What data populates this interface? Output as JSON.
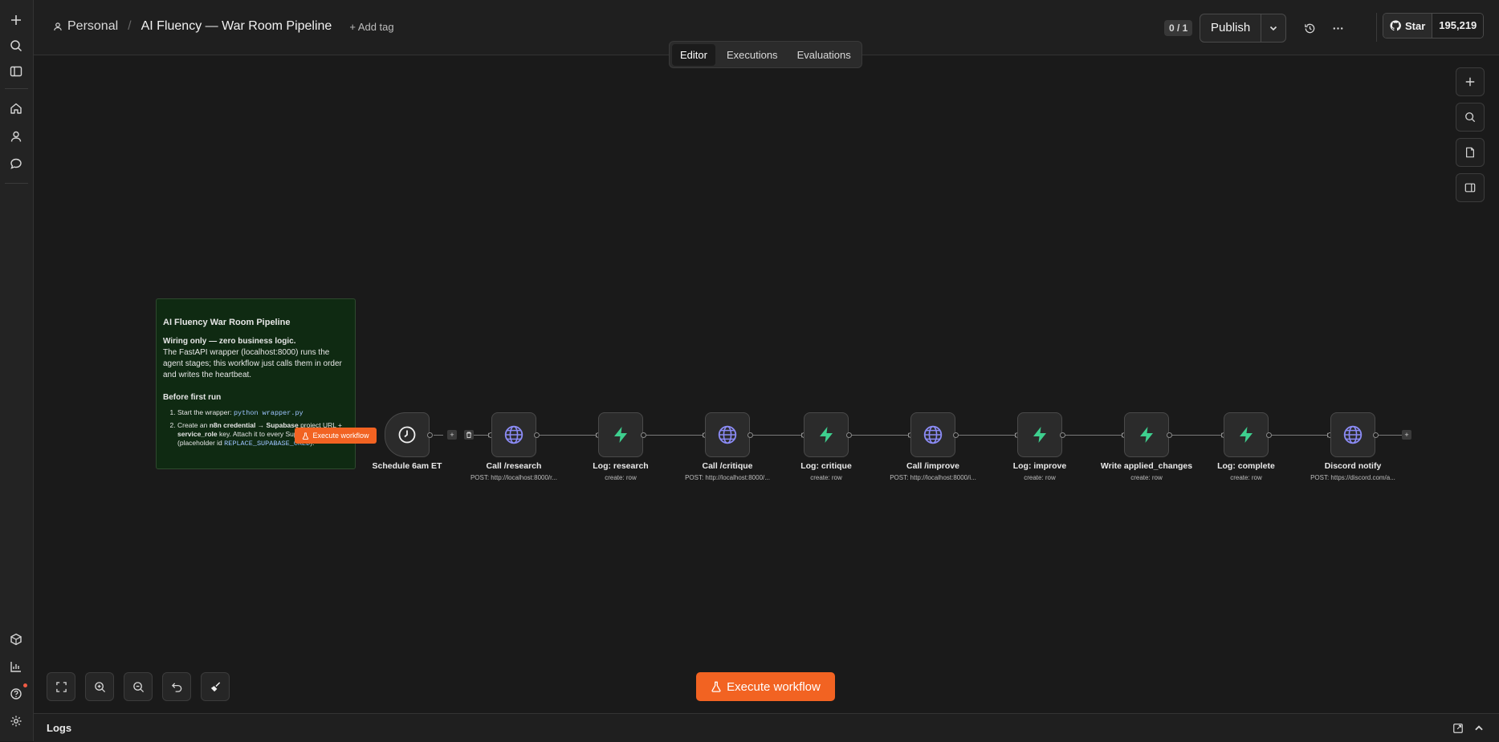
{
  "header": {
    "project": "Personal",
    "workflow_title": "AI Fluency — War Room Pipeline",
    "add_tag": "+ Add tag",
    "counter": "0 / 1",
    "publish_label": "Publish",
    "github_star_label": "Star",
    "github_star_count": "195,219"
  },
  "tabs": [
    "Editor",
    "Executions",
    "Evaluations"
  ],
  "active_tab": "Editor",
  "sticky_note": {
    "title": "AI Fluency War Room Pipeline",
    "lead_bold": "Wiring only — zero business logic.",
    "lead_text": "The FastAPI wrapper (localhost:8000) runs the agent stages; this workflow just calls them in order and writes the heartbeat.",
    "section_title": "Before first run",
    "step1_text": "Start the wrapper:",
    "step1_code": "python wrapper.py",
    "step2_pre": "Create an ",
    "step2_bold1": "n8n credential → Supabase",
    "step2_mid": " project URL + ",
    "step2_bold2": "service_role",
    "step2_post": " key. Attach it to every Supabase node (placeholder id",
    "step2_code": "REPLACE_SUPABASE_CRED",
    "step2_end": ")."
  },
  "execute_mini_label": "Execute workflow",
  "nodes": [
    {
      "label": "Schedule 6am ET",
      "subtitle": "",
      "icon": "clock-icon"
    },
    {
      "label": "Call /research",
      "subtitle": "POST: http://localhost:8000/r...",
      "icon": "globe-icon"
    },
    {
      "label": "Log: research",
      "subtitle": "create: row",
      "icon": "supabase-icon"
    },
    {
      "label": "Call /critique",
      "subtitle": "POST: http://localhost:8000/...",
      "icon": "globe-icon"
    },
    {
      "label": "Log: critique",
      "subtitle": "create: row",
      "icon": "supabase-icon"
    },
    {
      "label": "Call /improve",
      "subtitle": "POST: http://localhost:8000/i...",
      "icon": "globe-icon"
    },
    {
      "label": "Log: improve",
      "subtitle": "create: row",
      "icon": "supabase-icon"
    },
    {
      "label": "Write applied_changes",
      "subtitle": "create: row",
      "icon": "supabase-icon"
    },
    {
      "label": "Log: complete",
      "subtitle": "create: row",
      "icon": "supabase-icon"
    },
    {
      "label": "Discord notify",
      "subtitle": "POST: https://discord.com/a...",
      "icon": "globe-icon"
    }
  ],
  "execute_button_label": "Execute workflow",
  "logs_label": "Logs",
  "colors": {
    "accent": "#f26322",
    "supabase": "#3ecf8e",
    "http": "#8b8bf5",
    "sticky_bg": "#0f2a12"
  }
}
